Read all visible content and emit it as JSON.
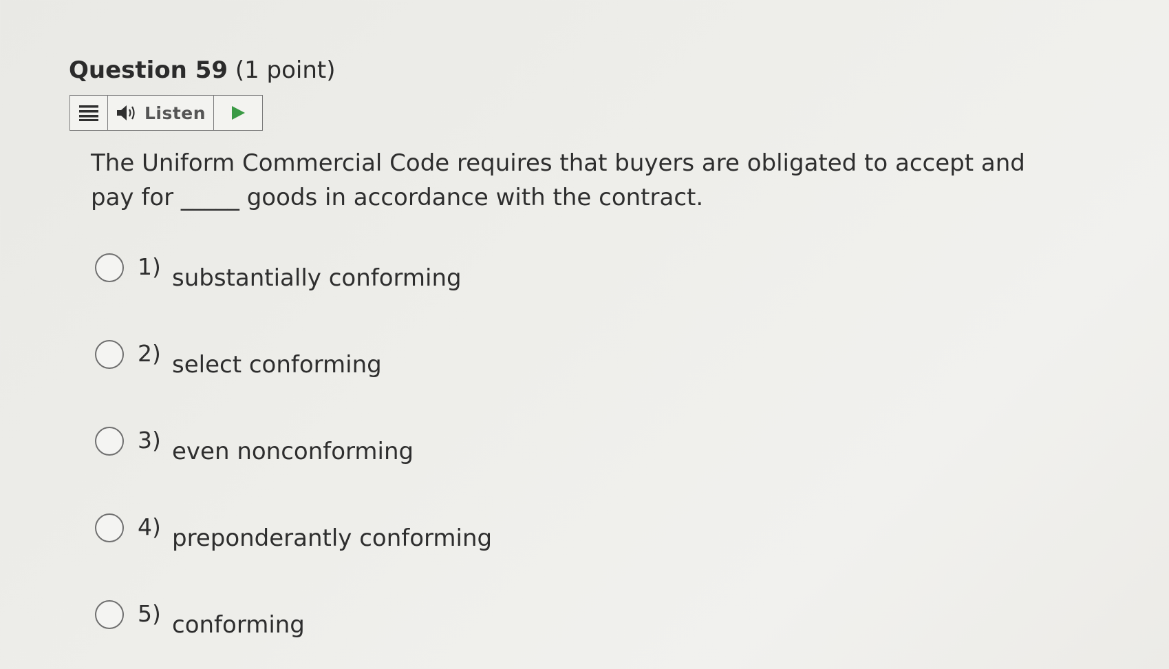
{
  "question": {
    "title": "Question 59",
    "points": "(1 point)",
    "text": "The Uniform Commercial Code requires that buyers are obligated to accept and pay for _____ goods in accordance with the contract."
  },
  "toolbar": {
    "menu_icon": "menu-icon",
    "speaker_icon": "speaker-icon",
    "listen_label": "Listen",
    "play_icon": "play-icon",
    "play_color": "#3a9a45"
  },
  "options": [
    {
      "number": "1)",
      "label": "substantially conforming",
      "selected": false
    },
    {
      "number": "2)",
      "label": "select conforming",
      "selected": false
    },
    {
      "number": "3)",
      "label": "even nonconforming",
      "selected": false
    },
    {
      "number": "4)",
      "label": "preponderantly conforming",
      "selected": false
    },
    {
      "number": "5)",
      "label": "conforming",
      "selected": false
    }
  ]
}
